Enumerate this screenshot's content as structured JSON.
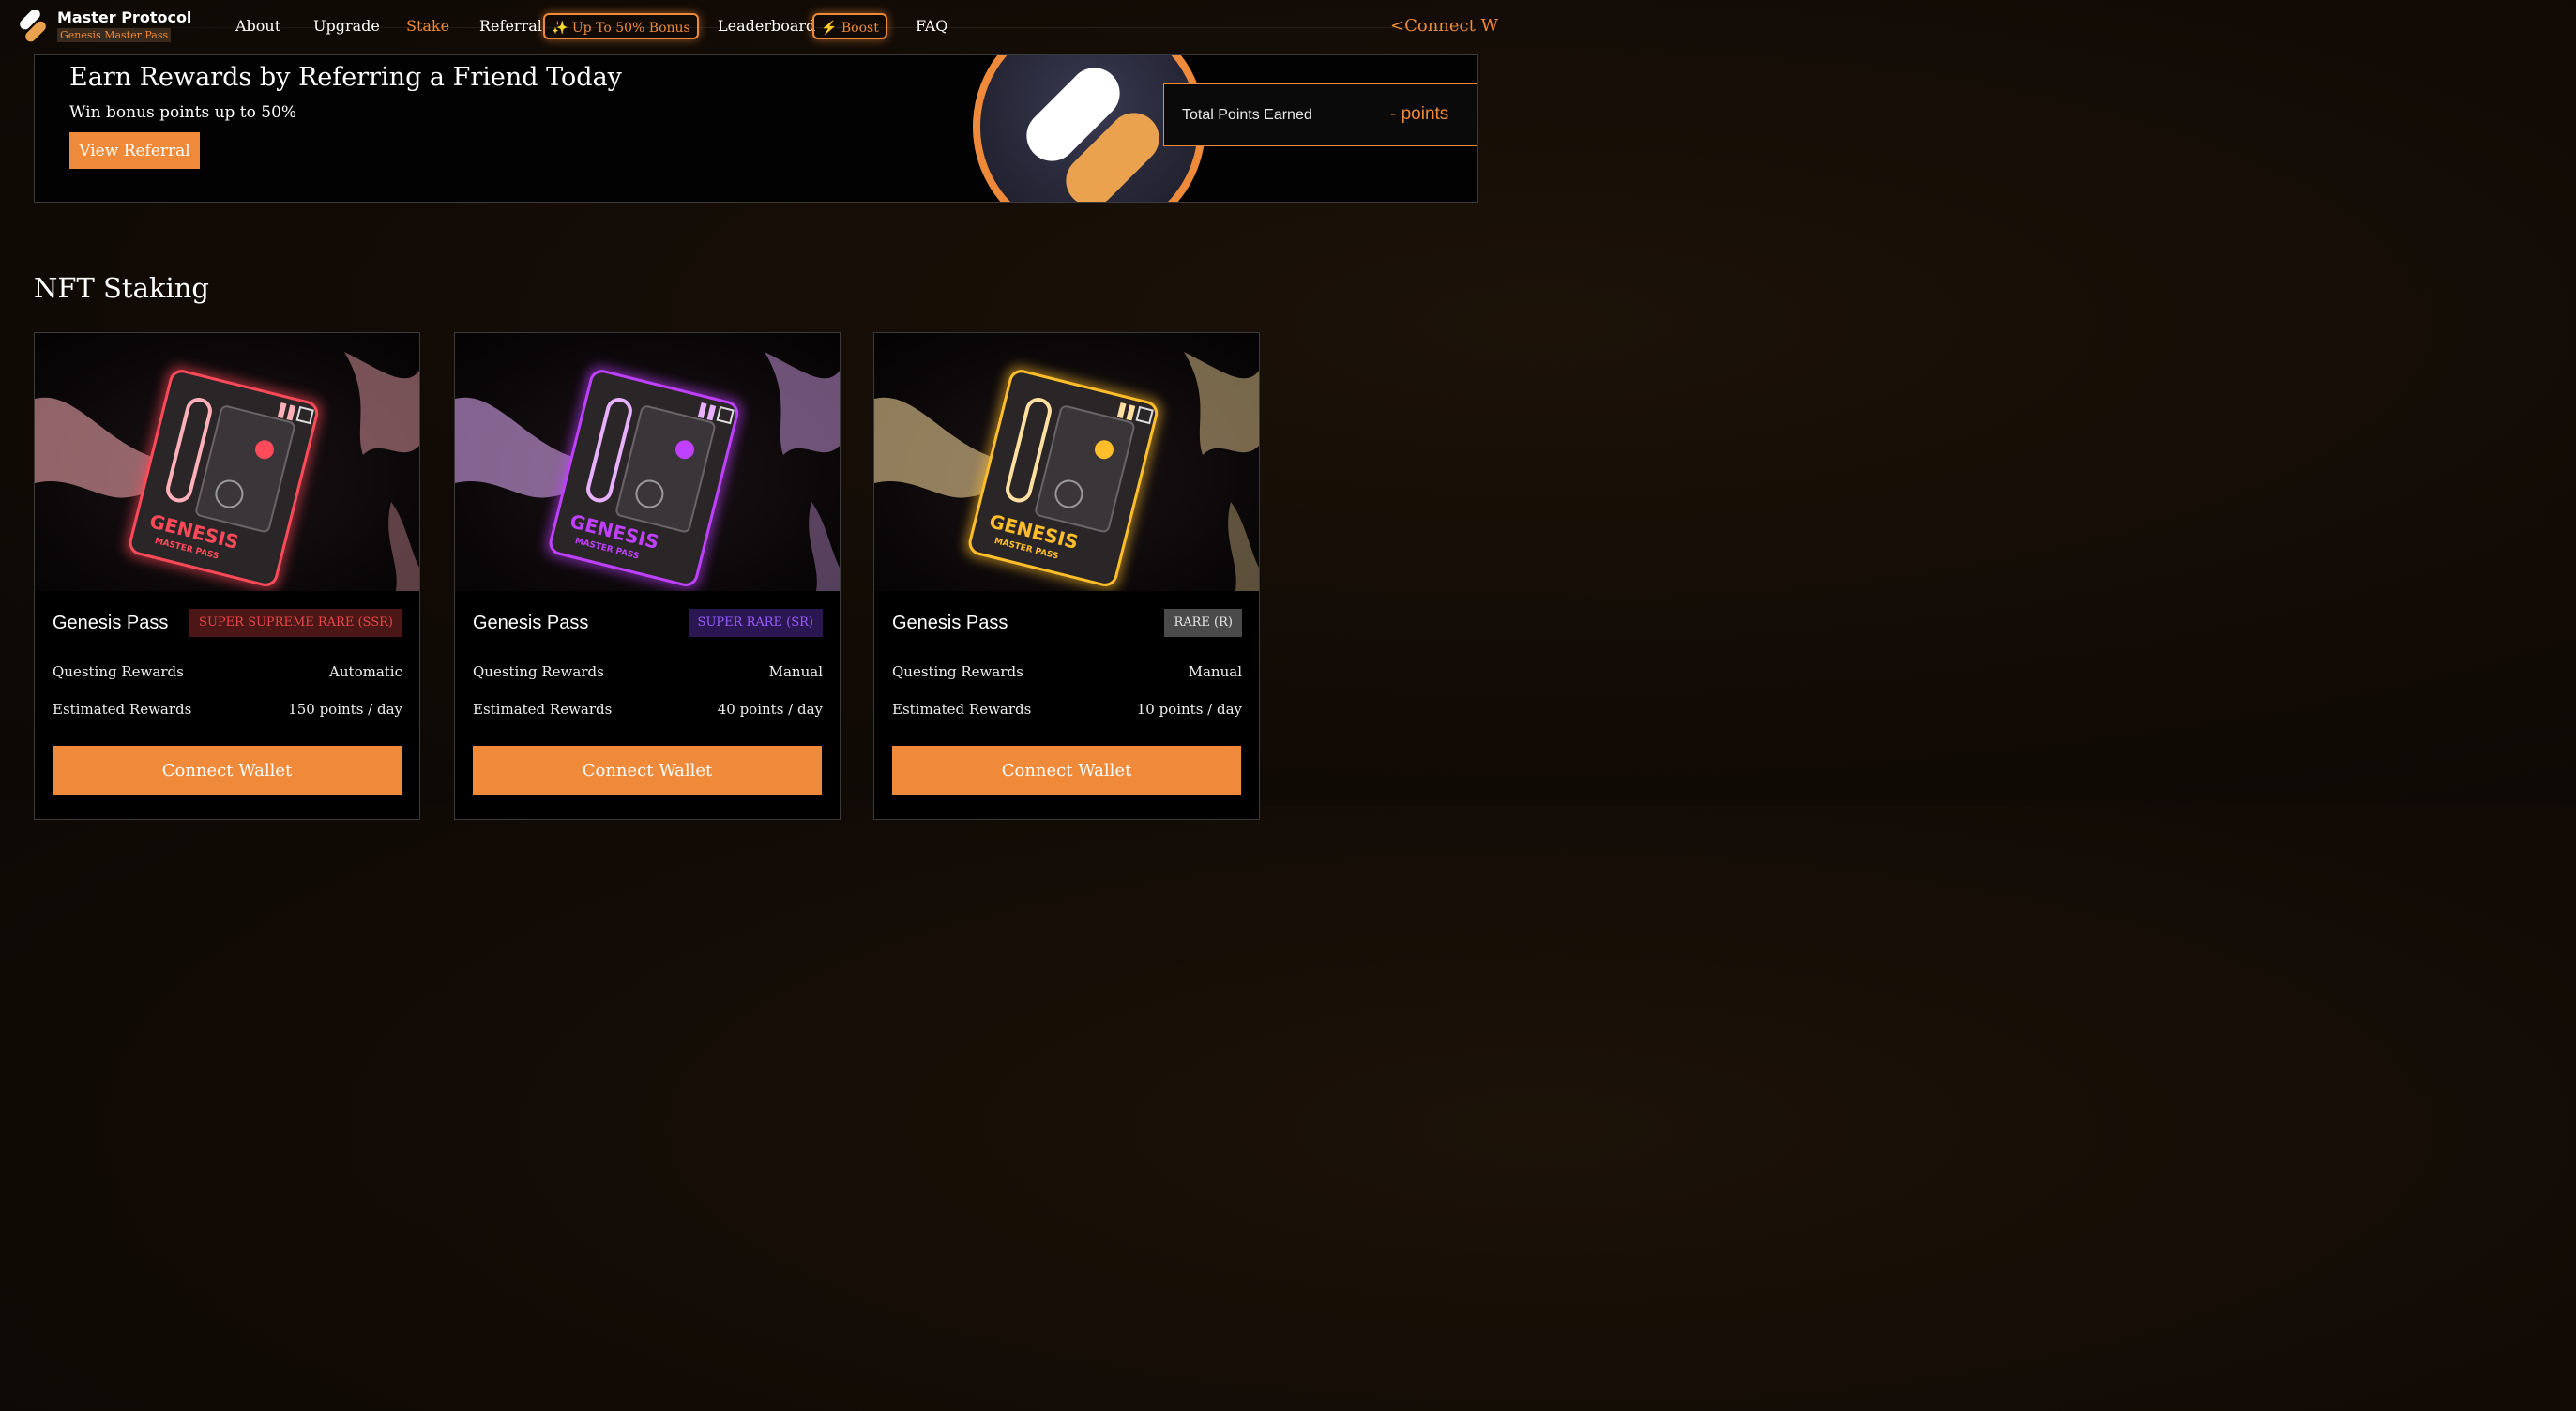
{
  "header": {
    "brand_name": "Master Protocol",
    "brand_sub": "Genesis Master Pass",
    "nav": {
      "about": "About",
      "upgrade": "Upgrade",
      "stake": "Stake",
      "referral": "Referral",
      "bonus_pill": "✨ Up To 50% Bonus",
      "leaderboard": "Leaderboard",
      "boost_pill": "⚡ Boost",
      "faq": "FAQ"
    },
    "connect_label": "<Connect W"
  },
  "banner": {
    "title": "Earn Rewards by Referring a Friend Today",
    "subtitle": "Win bonus points up to 50%",
    "button_label": "View Referral",
    "points_label": "Total Points Earned",
    "points_value": "- points"
  },
  "staking": {
    "title": "NFT Staking",
    "cards": [
      {
        "name": "Genesis Pass",
        "rarity": "SUPER SUPREME RARE (SSR)",
        "questing_label": "Questing Rewards",
        "questing_value": "Automatic",
        "estimated_label": "Estimated Rewards",
        "estimated_value": "150 points / day",
        "button_label": "Connect Wallet",
        "badge_bg": "#4a1616",
        "badge_fg": "#e8484a",
        "glow": "#ff4a5a",
        "accent": "#ffb0b8"
      },
      {
        "name": "Genesis Pass",
        "rarity": "SUPER RARE (SR)",
        "questing_label": "Questing Rewards",
        "questing_value": "Manual",
        "estimated_label": "Estimated Rewards",
        "estimated_value": "40 points / day",
        "button_label": "Connect Wallet",
        "badge_bg": "#2a1650",
        "badge_fg": "#9a5cff",
        "glow": "#c040ff",
        "accent": "#e8b0ff"
      },
      {
        "name": "Genesis Pass",
        "rarity": "RARE (R)",
        "questing_label": "Questing Rewards",
        "questing_value": "Manual",
        "estimated_label": "Estimated Rewards",
        "estimated_value": "10 points / day",
        "button_label": "Connect Wallet",
        "badge_bg": "#4a4a4a",
        "badge_fg": "#e6e6e6",
        "glow": "#ffbe2a",
        "accent": "#ffe0a0"
      }
    ]
  },
  "colors": {
    "accent": "#ee8a3a",
    "background": "#120b05"
  }
}
